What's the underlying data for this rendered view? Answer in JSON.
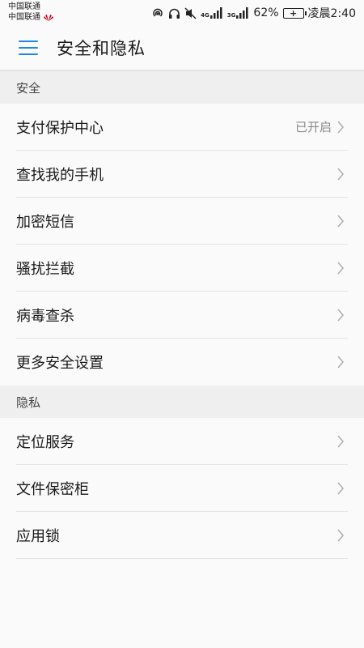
{
  "status_bar": {
    "carrier_1": "中国联通",
    "carrier_2": "中国联通",
    "network_1": "4G",
    "network_2": "3G",
    "battery_percent": "62%",
    "time": "凌晨2:40"
  },
  "header": {
    "title": "安全和隐私"
  },
  "sections": [
    {
      "title": "安全",
      "items": [
        {
          "label": "支付保护中心",
          "value": "已开启"
        },
        {
          "label": "查找我的手机",
          "value": ""
        },
        {
          "label": "加密短信",
          "value": ""
        },
        {
          "label": "骚扰拦截",
          "value": ""
        },
        {
          "label": "病毒查杀",
          "value": ""
        },
        {
          "label": "更多安全设置",
          "value": ""
        }
      ]
    },
    {
      "title": "隐私",
      "items": [
        {
          "label": "定位服务",
          "value": ""
        },
        {
          "label": "文件保密柜",
          "value": ""
        },
        {
          "label": "应用锁",
          "value": ""
        }
      ]
    }
  ],
  "colors": {
    "accent": "#1e88e5",
    "section_bg": "#efefef",
    "page_bg": "#fafafa"
  }
}
